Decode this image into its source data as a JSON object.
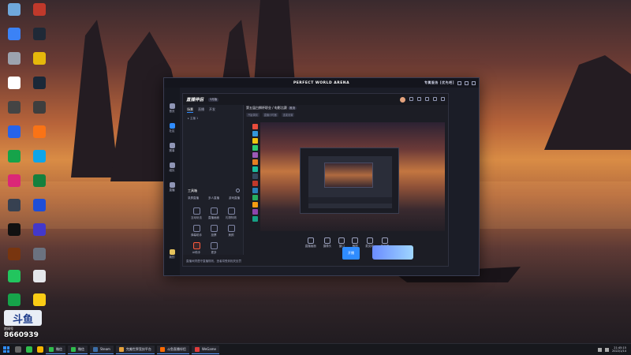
{
  "window": {
    "title": "PERFECT WORLD ARENA",
    "controls_label": "专属服务 [优先吧]"
  },
  "outer_sidebar": [
    {
      "label": "首页",
      "icon": "home-icon"
    },
    {
      "label": "社区",
      "icon": "compass-icon"
    },
    {
      "label": "赛事",
      "icon": "trophy-icon"
    },
    {
      "label": "组队",
      "icon": "team-icon"
    },
    {
      "label": "直播",
      "icon": "broadcast-icon"
    },
    {
      "label": "我的",
      "icon": "gem-icon"
    }
  ],
  "app": {
    "logo": "直播伴侣",
    "pill": "3月版",
    "tabs": [
      "场景",
      "直播",
      "开发"
    ],
    "tree_item": "主播 1",
    "stream_title": "第五届白狮杯职业 / 电影比赛",
    "stream_tag": "推流",
    "meta": [
      "开始录制",
      "直播计时器",
      "连麦设置"
    ],
    "toolbox_title": "工具箱",
    "toolbox_row": [
      "录屏直播",
      "多人直播",
      "游戏直播"
    ],
    "tools": [
      {
        "label": "互动玩法",
        "hot": false
      },
      {
        "label": "直播画面",
        "hot": false
      },
      {
        "label": "礼物特效",
        "hot": false
      },
      {
        "label": "弹幕助手",
        "hot": false
      },
      {
        "label": "投票",
        "hot": false
      },
      {
        "label": "美颜",
        "hot": false
      },
      {
        "label": "AI助手",
        "hot": true
      },
      {
        "label": "更多",
        "hot": false
      }
    ],
    "controls": [
      {
        "label": "直播画面",
        "icon": "screen-icon"
      },
      {
        "label": "摄像头",
        "icon": "camera-icon"
      },
      {
        "label": "窗口",
        "icon": "window-icon"
      },
      {
        "label": "截图",
        "icon": "crop-icon"
      },
      {
        "label": "麦克风",
        "icon": "mic-icon"
      },
      {
        "label": "扬声器",
        "icon": "speaker-icon"
      }
    ],
    "start_button": "开播",
    "bottom_note": "直播间须遵守直播规则，违者将受到相关处罚"
  },
  "watermark": {
    "logo": "斗鱼",
    "sub": "房间号",
    "number": "8660939"
  },
  "taskbar": {
    "tasks": [
      {
        "label": "微信",
        "color": "#2fbd4c"
      },
      {
        "label": "微信",
        "color": "#2fbd4c"
      },
      {
        "label": "Steam",
        "color": "#3b6ea8"
      },
      {
        "label": "完美世界竞技平台",
        "color": "#e6a23c"
      },
      {
        "label": "斗鱼直播伴侣",
        "color": "#ff6a00"
      },
      {
        "label": "WeGame",
        "color": "#e03c3c"
      }
    ],
    "time": "21:45:15",
    "date": "2022/1/14"
  }
}
